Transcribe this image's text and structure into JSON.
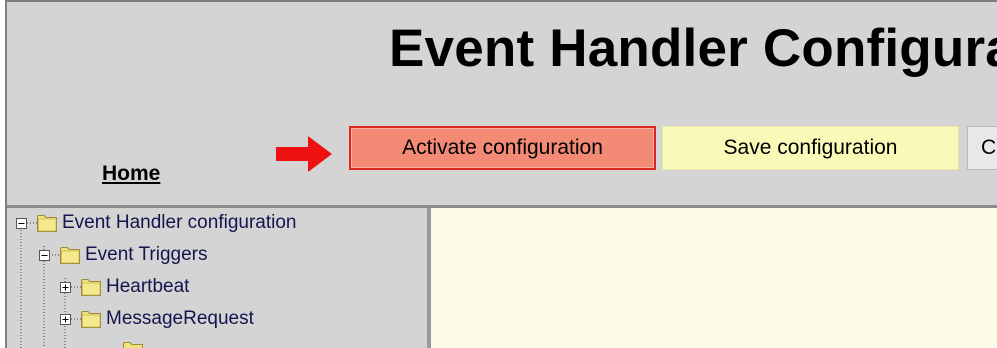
{
  "header": {
    "title": "Event Handler Configuration",
    "home_label": "Home"
  },
  "toolbar": {
    "activate_label": "Activate configuration",
    "save_label": "Save configuration",
    "third_label_partial": "C"
  },
  "tree": {
    "items": [
      {
        "label": "Event Handler configuration",
        "expander": "minus"
      },
      {
        "label": "Event Triggers",
        "expander": "minus"
      },
      {
        "label": "Heartbeat",
        "expander": "plus"
      },
      {
        "label": "MessageRequest",
        "expander": "plus"
      }
    ]
  },
  "colors": {
    "activate_bg": "#f38a75",
    "activate_border": "#e0271d",
    "save_bg": "#fafab8",
    "arrow": "#ee1111",
    "folder": "#f3e27a",
    "right_pane_bg": "#fdfde7",
    "header_bg": "#d4d4d4"
  },
  "icons": {
    "pointer": "red-arrow-right-icon",
    "folder": "folder-icon",
    "expand": "plus-box-icon",
    "collapse": "minus-box-icon"
  }
}
